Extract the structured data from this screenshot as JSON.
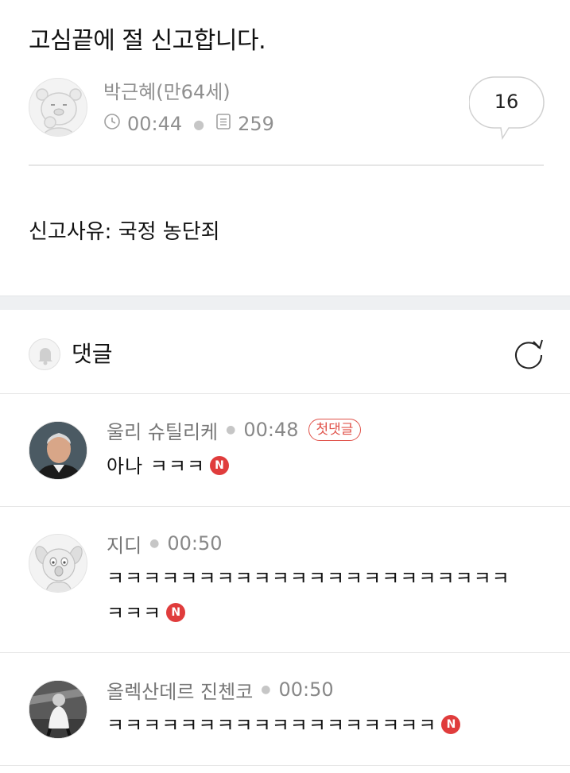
{
  "post": {
    "title": "고심끝에 절 신고합니다.",
    "author": "박근혜(만64세)",
    "time": "00:44",
    "views": "259",
    "comment_count": "16",
    "body": "신고사유: 국정 농단죄"
  },
  "comments_section": {
    "title": "댓글"
  },
  "comments": [
    {
      "author": "울리 슈틸리케",
      "time": "00:48",
      "badge": "첫댓글",
      "text": "아나 ㅋㅋㅋ",
      "new_badge": "N"
    },
    {
      "author": "지디",
      "time": "00:50",
      "text": "ㅋㅋㅋㅋㅋㅋㅋㅋㅋㅋㅋㅋㅋㅋㅋㅋㅋㅋㅋㅋㅋㅋㅋㅋㅋ",
      "new_badge": "N"
    },
    {
      "author": "올렉산데르 진첸코",
      "time": "00:50",
      "text": "ㅋㅋㅋㅋㅋㅋㅋㅋㅋㅋㅋㅋㅋㅋㅋㅋㅋㅋ",
      "new_badge": "N"
    }
  ],
  "icons": {
    "clock": "clock-icon",
    "views": "document-icon",
    "comment": "speech-bubble-icon",
    "bell": "bell-icon",
    "refresh": "refresh-icon"
  },
  "colors": {
    "accent_red": "#e03c3c",
    "meta_gray": "#909090",
    "divider": "#e6e6e6"
  }
}
